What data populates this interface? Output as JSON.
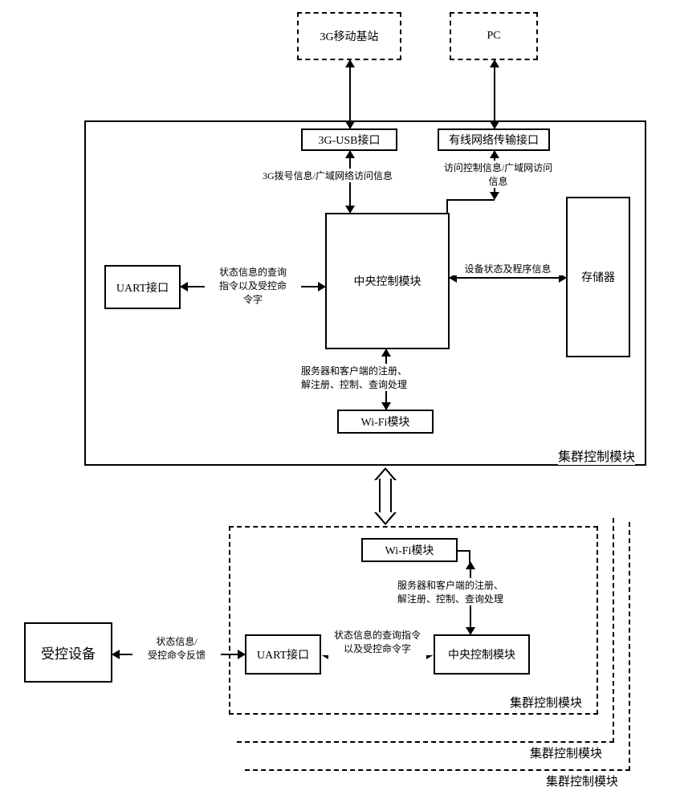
{
  "top": {
    "base_station": "3G移动基站",
    "pc": "PC"
  },
  "main": {
    "title": "集群控制模块",
    "usb_if": "3G-USB接口",
    "wired_if": "有线网络传输接口",
    "uart_if": "UART接口",
    "center_ctrl": "中央控制模块",
    "storage": "存储器",
    "wifi": "Wi-Fi模块"
  },
  "edge_labels": {
    "usb_to_center": "3G拨号信息/广域网络访问信息",
    "wired_to_center": "访问控制信息/广域网访问\n信息",
    "uart_to_center": "状态信息的查询\n指令以及受控命\n令字",
    "center_to_storage": "设备状态及程序信息",
    "center_to_wifi": "服务器和客户端的注册、\n解注册、控制、查询处理"
  },
  "bottom": {
    "controlled_device": "受控设备",
    "uart_if": "UART接口",
    "center_ctrl": "中央控制模块",
    "wifi": "Wi-Fi模块",
    "cluster_inner": "集群控制模块",
    "cluster_mid": "集群控制模块",
    "cluster_outer": "集群控制模块",
    "dev_to_uart": "状态信息/\n受控命令反馈",
    "uart_to_center": "状态信息的查询指令\n以及受控命令字",
    "wifi_to_center": "服务器和客户端的注册、\n解注册、控制、查询处理"
  }
}
